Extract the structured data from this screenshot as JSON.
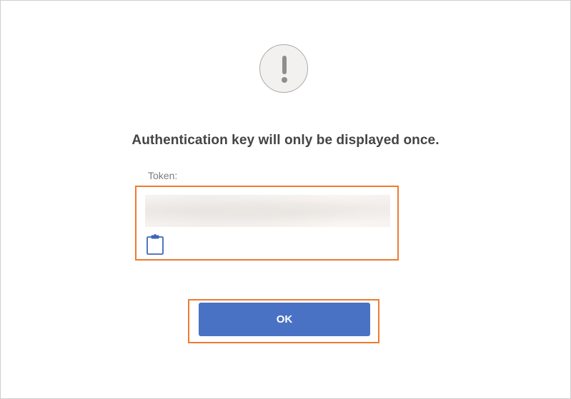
{
  "dialog": {
    "icon": "exclamation-icon",
    "title": "Authentication key will only be displayed once.",
    "token_label": "Token:",
    "token_value": "",
    "copy_icon": "clipboard-icon",
    "ok_label": "OK"
  },
  "colors": {
    "accent_blue": "#4a72c4",
    "highlight_orange": "#ee7b2f",
    "title_text": "#444444",
    "label_text": "#7b7b7b"
  }
}
